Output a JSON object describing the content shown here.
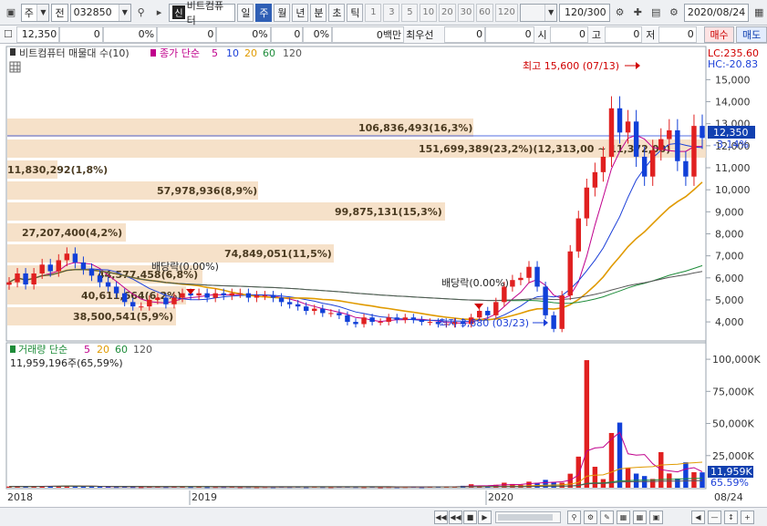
{
  "toolbar": {
    "menu_icon": "window-icon",
    "market": "주",
    "prev_label": "전",
    "code": "032850",
    "stock_name_badge": "신",
    "stock_name": "비트컴퓨터",
    "periods": [
      "일",
      "주",
      "월",
      "년",
      "분",
      "초",
      "틱"
    ],
    "active_period": "주",
    "intervals": [
      "1",
      "3",
      "5",
      "10",
      "20",
      "30",
      "60",
      "120"
    ],
    "count": "120",
    "count_total": "/300",
    "date": "2020/08/24"
  },
  "quote": {
    "price": "12,350",
    "change": "0",
    "change_pct": "0%",
    "v2": "0",
    "v2_pct": "0%",
    "v3": "0",
    "v3_pct": "0%",
    "amount": "0백만",
    "priority_label": "최우선",
    "p1": "0",
    "p2": "0",
    "open_label": "시",
    "open": "0",
    "high_label": "고",
    "high": "0",
    "low_label": "저",
    "low": "0",
    "buy_label": "매수",
    "sell_label": "매도"
  },
  "price_legend": {
    "title": "비트컴퓨터 매물대 수(10)",
    "ma_label": "종가 단순",
    "ma_periods": [
      "5",
      "10",
      "20",
      "60",
      "120"
    ],
    "ma_colors": [
      "#c0008c",
      "#1b3fd8",
      "#e09a00",
      "#1e8c3a",
      "#555555"
    ]
  },
  "volume_legend": {
    "label": "거래량 단순",
    "ma_periods": [
      "5",
      "20",
      "60",
      "120"
    ],
    "ma_colors": [
      "#c0008c",
      "#e09a00",
      "#1e8c3a",
      "#555555"
    ],
    "current": "11,959,196주(65,59%)"
  },
  "annotations": {
    "high": "최고 15,600 (07/13)",
    "low": "최저 3,680 (03/23)",
    "dividend": "배당락",
    "dividend2": "배당락(0.00%)",
    "dividend3": "배당락(0.00%)",
    "lc": "LC:235.60",
    "hc": "HC:-20.83",
    "current_price": "12,350",
    "current_pct": "-3.14%",
    "current_volume": "11,959K",
    "current_volume_pct": "65.59%"
  },
  "volume_profile": [
    {
      "label": "106,836,493(16,3%)"
    },
    {
      "label": "151,699,389(23,2%)(12,313,00 ~ 11,372,00)"
    },
    {
      "label": "11,830,292(1,8%)"
    },
    {
      "label": "57,978,936(8,9%)"
    },
    {
      "label": "99,875,131(15,3%)"
    },
    {
      "label": "27,207,400(4,2%)"
    },
    {
      "label": "74,849,051(11,5%)"
    },
    {
      "label": "44,577,458(6,8%)"
    },
    {
      "label": "40,611,664(6,2%)"
    },
    {
      "label": "38,500,541(5,9%)"
    }
  ],
  "chart_data": {
    "type": "candlestick",
    "x_axis_labels": [
      "2018",
      "2019",
      "2020",
      "08/24"
    ],
    "price_axis": {
      "ticks": [
        "15,000",
        "14,000",
        "13,000",
        "12,000",
        "11,000",
        "10,000",
        "9,000",
        "8,000",
        "7,000",
        "6,000",
        "5,000",
        "4,000"
      ],
      "ylim": [
        3300,
        16300
      ]
    },
    "volume_axis": {
      "ticks": [
        "100,000K",
        "75,000K",
        "50,000K",
        "25,000K"
      ],
      "ylim": [
        0,
        110000
      ]
    },
    "series": [
      {
        "name": "종가",
        "values": [
          5800,
          6200,
          5700,
          6200,
          6600,
          6300,
          6800,
          7100,
          6700,
          6400,
          6100,
          5800,
          5600,
          5300,
          4900,
          4700,
          4700,
          5000,
          5100,
          4800,
          5100,
          5300,
          5200,
          5300,
          5100,
          5300,
          5200,
          5300,
          5300,
          5100,
          5200,
          5200,
          5100,
          4900,
          4800,
          4700,
          4500,
          4600,
          4400,
          4400,
          4300,
          4000,
          3900,
          4200,
          4000,
          4000,
          4200,
          4100,
          4200,
          4100,
          4000,
          4000,
          3900,
          3900,
          4000,
          3900,
          4200,
          4500,
          4300,
          4900,
          5600,
          5900,
          6000,
          6500,
          5600,
          4300,
          3680,
          5200,
          7200,
          8700,
          10100,
          10800,
          11500,
          13700,
          12600,
          13100,
          11500,
          10600,
          11800,
          12300,
          12700,
          11300,
          10600,
          12900,
          12350
        ]
      },
      {
        "name": "거래량",
        "values": [
          900,
          1200,
          800,
          1100,
          1400,
          1000,
          1300,
          1700,
          1200,
          900,
          800,
          700,
          800,
          600,
          900,
          600,
          500,
          700,
          800,
          600,
          700,
          900,
          600,
          700,
          500,
          600,
          600,
          700,
          500,
          600,
          500,
          600,
          500,
          700,
          600,
          800,
          500,
          700,
          600,
          500,
          700,
          800,
          600,
          500,
          700,
          400,
          600,
          500,
          600,
          700,
          500,
          800,
          900,
          700,
          800,
          1500,
          2700,
          1700,
          1200,
          2300,
          3900,
          2900,
          2300,
          4700,
          3800,
          6100,
          4400,
          3900,
          10900,
          24200,
          99300,
          16300,
          6700,
          42600,
          50700,
          15700,
          11000,
          9100,
          6800,
          27700,
          11100,
          7200,
          19800,
          12100,
          11959
        ]
      }
    ]
  }
}
